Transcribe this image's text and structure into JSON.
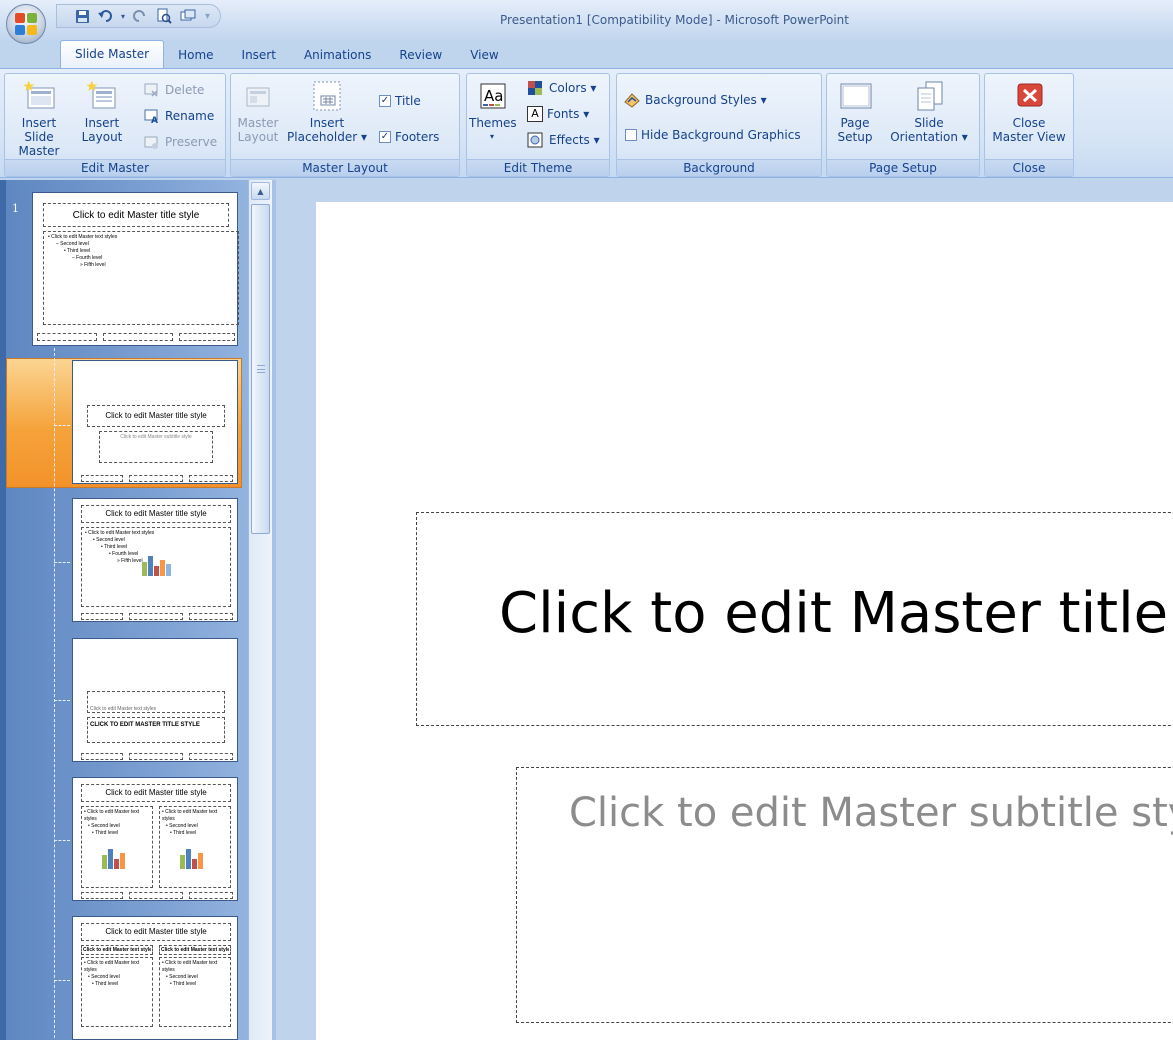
{
  "window": {
    "title": "Presentation1 [Compatibility Mode] - Microsoft PowerPoint"
  },
  "qat": {
    "items": [
      "save-icon",
      "undo-icon",
      "redo-icon",
      "print-preview-icon",
      "new-slide-icon",
      "customize-arrow"
    ]
  },
  "tabs": [
    {
      "label": "Slide Master",
      "active": true
    },
    {
      "label": "Home"
    },
    {
      "label": "Insert"
    },
    {
      "label": "Animations"
    },
    {
      "label": "Review"
    },
    {
      "label": "View"
    }
  ],
  "ribbon": {
    "edit_master": {
      "label": "Edit Master",
      "insert_slide_master": "Insert Slide\nMaster",
      "insert_layout": "Insert\nLayout",
      "delete": "Delete",
      "rename": "Rename",
      "preserve": "Preserve"
    },
    "master_layout": {
      "label": "Master Layout",
      "master_layout_btn": "Master\nLayout",
      "insert_placeholder": "Insert\nPlaceholder ▾",
      "title_check": "Title",
      "footers_check": "Footers"
    },
    "edit_theme": {
      "label": "Edit Theme",
      "themes": "Themes",
      "colors": "Colors ▾",
      "fonts": "Fonts ▾",
      "effects": "Effects ▾"
    },
    "background": {
      "label": "Background",
      "background_styles": "Background Styles ▾",
      "hide_background": "Hide Background Graphics"
    },
    "page_setup": {
      "label": "Page Setup",
      "page_setup_btn": "Page\nSetup",
      "slide_orientation": "Slide\nOrientation ▾"
    },
    "close": {
      "label": "Close",
      "close_master_view": "Close\nMaster View"
    }
  },
  "thumbnails": {
    "master_number": "1",
    "master": {
      "title": "Click to edit Master title style",
      "body": [
        "• Click to edit Master text styles",
        "– Second level",
        "• Third level",
        "– Fourth level",
        "» Fifth level"
      ]
    },
    "layout_title": {
      "title": "Click to edit Master title style",
      "subtitle": "Click to edit Master subtitle style"
    },
    "layout_content": {
      "title": "Click to edit Master title style",
      "body": [
        "• Click to edit Master text styles",
        "• Second level",
        "• Third level",
        "• Fourth level",
        "» Fifth level"
      ]
    },
    "layout_section": {
      "text": "Click to edit Master text styles",
      "title": "CLICK TO EDIT MASTER TITLE STYLE"
    },
    "layout_two_content": {
      "title": "Click to edit Master title style",
      "left": [
        "• Click to edit Master text styles",
        "• Second level",
        "• Third level"
      ],
      "right": [
        "• Click to edit Master text styles",
        "• Second level",
        "• Third level"
      ]
    },
    "layout_comparison": {
      "title": "Click to edit Master title style",
      "left_head": "Click to edit Master text styles",
      "right_head": "Click to edit Master text styles",
      "left": [
        "• Click to edit Master text styles",
        "• Second level",
        "• Third level"
      ],
      "right": [
        "• Click to edit Master text styles",
        "• Second level",
        "• Third level"
      ]
    }
  },
  "slide": {
    "title": "Click to edit Master title style",
    "subtitle": "Click to edit Master subtitle style"
  }
}
